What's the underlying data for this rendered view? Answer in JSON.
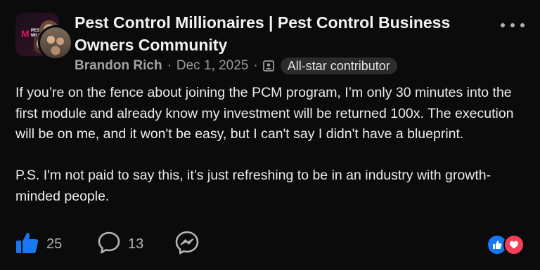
{
  "header": {
    "group_name": "Pest Control Millionaires | Pest Control Business Owners Community",
    "group_logo_text_line1": "PEST",
    "group_logo_text_line2": "MILL",
    "group_logo_letter": "M",
    "author": "Brandon Rich",
    "separator": "·",
    "date": "Dec 1, 2025",
    "badge": "All-star contributor"
  },
  "post": {
    "paragraph1": "If you’re on the fence about joining the PCM program, I’m only 30 minutes into the first module and already know my investment will be returned 100x. The execution will be on me, and it won't be easy, but I can't say I didn't have a blueprint.",
    "paragraph2": "P.S. I'm not paid to say this, it’s just refreshing to be in an industry with growth-minded people."
  },
  "footer": {
    "like_count": "25",
    "comment_count": "13"
  },
  "icons": {
    "like": "thumbs-up-icon",
    "comment": "comment-bubble-icon",
    "share": "messenger-icon",
    "more": "more-horizontal-icon",
    "badge": "contributor-badge-icon"
  },
  "colors": {
    "background": "#0b0b0b",
    "like_blue": "#1877f2",
    "love_red": "#f33e58",
    "badge_bg": "#2c2c2c"
  }
}
